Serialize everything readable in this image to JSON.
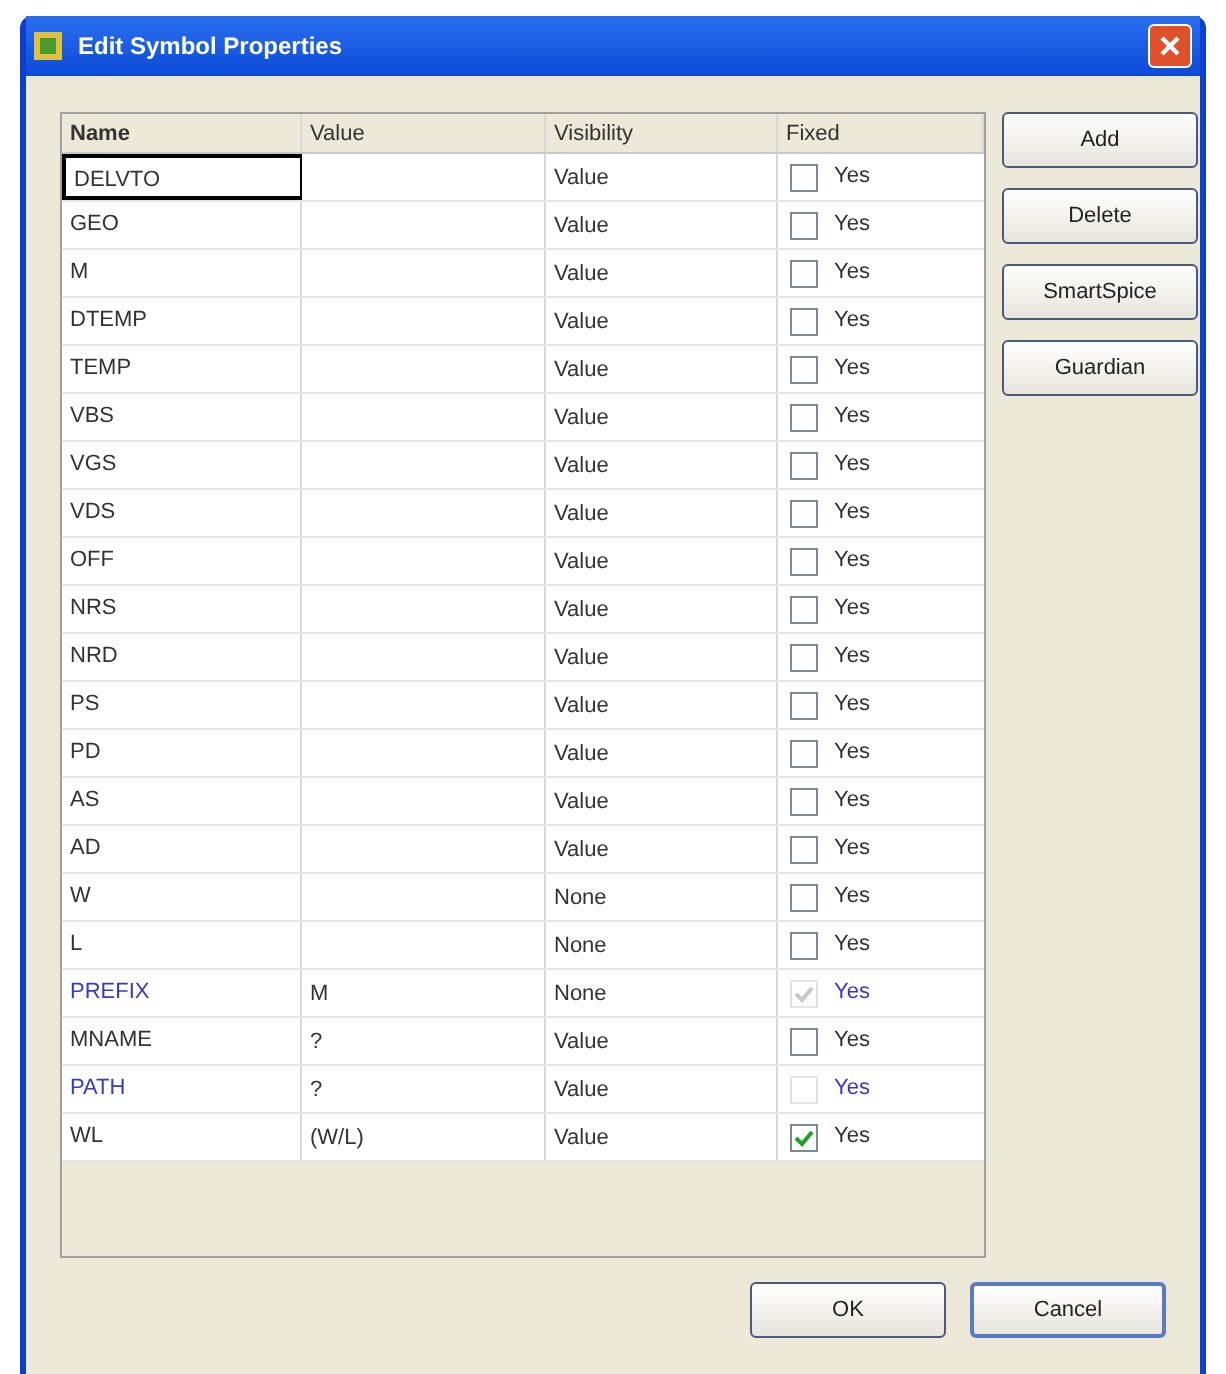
{
  "window": {
    "title": "Edit Symbol Properties"
  },
  "table": {
    "columns": [
      "Name",
      "Value",
      "Visibility",
      "Fixed"
    ],
    "rows": [
      {
        "name": "DELVTO",
        "visibility": "Value",
        "fixed_label": "Yes",
        "checked": false,
        "disabled": false,
        "selected": true
      },
      {
        "name": "GEO",
        "visibility": "Value",
        "fixed_label": "Yes",
        "checked": false,
        "disabled": false,
        "selected": false
      },
      {
        "name": "M",
        "visibility": "Value",
        "fixed_label": "Yes",
        "checked": false,
        "disabled": false,
        "selected": false
      },
      {
        "name": "DTEMP",
        "visibility": "Value",
        "fixed_label": "Yes",
        "checked": false,
        "disabled": false,
        "selected": false
      },
      {
        "name": "TEMP",
        "visibility": "Value",
        "fixed_label": "Yes",
        "checked": false,
        "disabled": false,
        "selected": false
      },
      {
        "name": "VBS",
        "visibility": "Value",
        "fixed_label": "Yes",
        "checked": false,
        "disabled": false,
        "selected": false
      },
      {
        "name": "VGS",
        "visibility": "Value",
        "fixed_label": "Yes",
        "checked": false,
        "disabled": false,
        "selected": false
      },
      {
        "name": "VDS",
        "visibility": "Value",
        "fixed_label": "Yes",
        "checked": false,
        "disabled": false,
        "selected": false
      },
      {
        "name": "OFF",
        "visibility": "Value",
        "fixed_label": "Yes",
        "checked": false,
        "disabled": false,
        "selected": false
      },
      {
        "name": "NRS",
        "visibility": "Value",
        "fixed_label": "Yes",
        "checked": false,
        "disabled": false,
        "selected": false
      },
      {
        "name": "NRD",
        "visibility": "Value",
        "fixed_label": "Yes",
        "checked": false,
        "disabled": false,
        "selected": false
      },
      {
        "name": "PS",
        "visibility": "Value",
        "fixed_label": "Yes",
        "checked": false,
        "disabled": false,
        "selected": false
      },
      {
        "name": "PD",
        "visibility": "Value",
        "fixed_label": "Yes",
        "checked": false,
        "disabled": false,
        "selected": false
      },
      {
        "name": "AS",
        "visibility": "Value",
        "fixed_label": "Yes",
        "checked": false,
        "disabled": false,
        "selected": false
      },
      {
        "name": "AD",
        "visibility": "Value",
        "fixed_label": "Yes",
        "checked": false,
        "disabled": false,
        "selected": false
      },
      {
        "name": "W",
        "visibility": "None",
        "fixed_label": "Yes",
        "checked": false,
        "disabled": false,
        "selected": false
      },
      {
        "name": "L",
        "visibility": "None",
        "fixed_label": "Yes",
        "checked": false,
        "disabled": false,
        "selected": false
      },
      {
        "name": "PREFIX",
        "value": "M",
        "visibility": "None",
        "fixed_label": "Yes",
        "checked": true,
        "disabled": true,
        "selected": false
      },
      {
        "name": "MNAME",
        "value": "?",
        "visibility": "Value",
        "fixed_label": "Yes",
        "checked": false,
        "disabled": false,
        "selected": false
      },
      {
        "name": "PATH",
        "value": "?",
        "visibility": "Value",
        "fixed_label": "Yes",
        "checked": false,
        "disabled": true,
        "selected": false
      },
      {
        "name": "WL",
        "value": "(W/L)",
        "visibility": "Value",
        "fixed_label": "Yes",
        "checked": true,
        "disabled": false,
        "selected": false
      }
    ]
  },
  "side_buttons": [
    "Add",
    "Delete",
    "SmartSpice",
    "Guardian"
  ],
  "buttons": [
    "OK",
    "Cancel"
  ]
}
